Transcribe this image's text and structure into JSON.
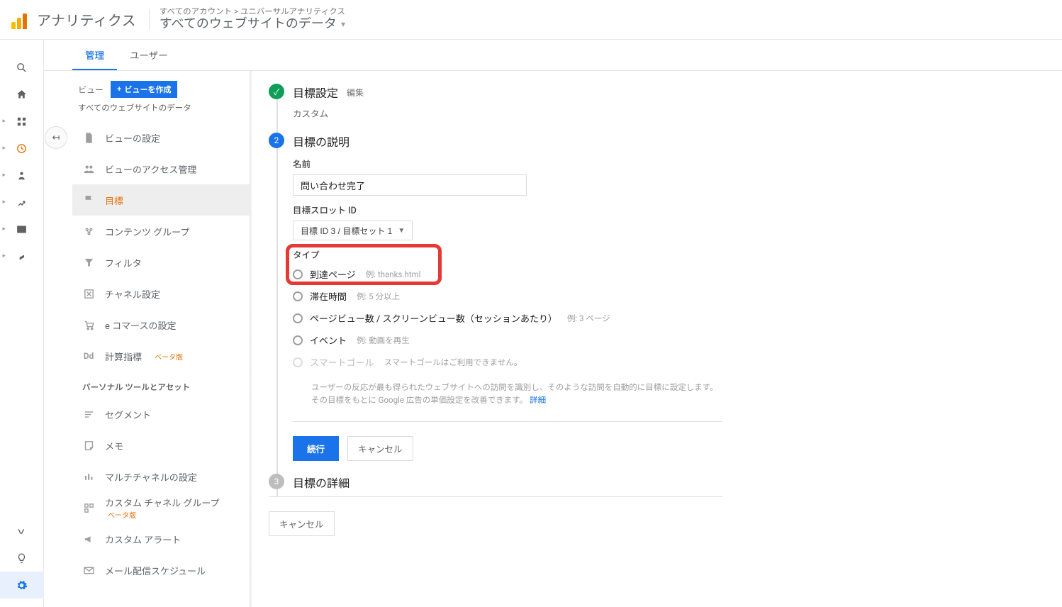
{
  "header": {
    "app_title": "アナリティクス",
    "breadcrumb_top": "すべてのアカウント > ユニバーサルアナリティクス",
    "breadcrumb_main": "すべてのウェブサイトのデータ"
  },
  "tabs": {
    "admin": "管理",
    "user": "ユーザー"
  },
  "admin_col": {
    "header_label": "ビュー",
    "create_button": "ビューを作成",
    "subtitle": "すべてのウェブサイトのデータ",
    "items": [
      "ビューの設定",
      "ビューのアクセス管理",
      "目標",
      "コンテンツ グループ",
      "フィルタ",
      "チャネル設定",
      "e コマースの設定",
      "計算指標"
    ],
    "beta_label": "ベータ版",
    "section_label": "パーソナル ツールとアセット",
    "personal": [
      "セグメント",
      "メモ",
      "マルチチャネルの設定",
      "カスタム チャネル グループ",
      "カスタム アラート",
      "メール配信スケジュール"
    ]
  },
  "steps": {
    "s1": {
      "title": "目標設定",
      "edit": "編集",
      "desc": "カスタム"
    },
    "s2": {
      "title": "目標の説明",
      "name_label": "名前",
      "name_value": "問い合わせ完了",
      "slot_label": "目標スロット ID",
      "slot_value": "目標 ID 3 / 目標セット 1",
      "type_label": "タイプ",
      "types": [
        {
          "label": "到達ページ",
          "hint": "例: thanks.html"
        },
        {
          "label": "滞在時間",
          "hint": "例: 5 分以上"
        },
        {
          "label": "ページビュー数 / スクリーンビュー数（セッションあたり）",
          "hint": "例: 3 ページ"
        },
        {
          "label": "イベント",
          "hint": "例: 動画を再生"
        },
        {
          "label": "スマートゴール",
          "hint": "スマートゴールはご利用できません。"
        }
      ],
      "smart_note": "ユーザーの反応が最も得られたウェブサイトへの訪問を識別し、そのような訪問を自動的に目標に設定します。その目標をもとに Google 広告の単価設定を改善できます。",
      "smart_link": "詳細",
      "continue": "続行",
      "cancel": "キャンセル"
    },
    "s3": {
      "title": "目標の詳細"
    }
  },
  "outer_cancel": "キャンセル"
}
